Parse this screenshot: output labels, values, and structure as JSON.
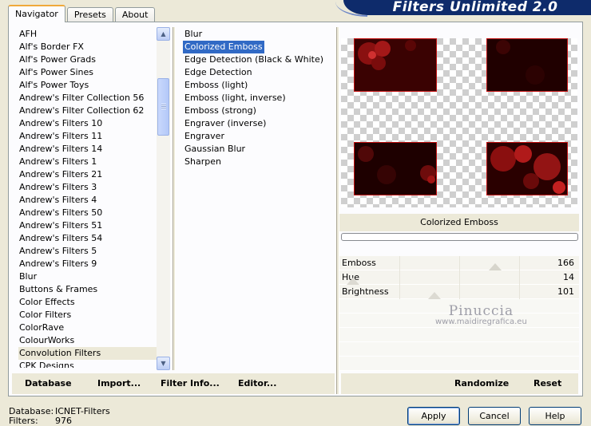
{
  "tabs": [
    {
      "label": "Navigator",
      "active": true
    },
    {
      "label": "Presets",
      "active": false
    },
    {
      "label": "About",
      "active": false
    }
  ],
  "banner": "Filters Unlimited 2.0",
  "categories": [
    "AFH",
    "Alf's Border FX",
    "Alf's Power Grads",
    "Alf's Power Sines",
    "Alf's Power Toys",
    "Andrew's Filter Collection 56",
    "Andrew's Filter Collection 62",
    "Andrew's Filters 10",
    "Andrew's Filters 11",
    "Andrew's Filters 14",
    "Andrew's Filters 1",
    "Andrew's Filters 21",
    "Andrew's Filters 3",
    "Andrew's Filters 4",
    "Andrew's Filters 50",
    "Andrew's Filters 51",
    "Andrew's Filters 54",
    "Andrew's Filters 5",
    "Andrew's Filters 9",
    "Blur",
    "Buttons & Frames",
    "Color Effects",
    "Color Filters",
    "ColorRave",
    "ColourWorks",
    "Convolution Filters",
    "CPK Designs"
  ],
  "selected_category": "Convolution Filters",
  "filters": [
    "Blur",
    "Colorized Emboss",
    "Edge Detection (Black & White)",
    "Edge Detection",
    "Emboss (light)",
    "Emboss (light, inverse)",
    "Emboss (strong)",
    "Engraver (inverse)",
    "Engraver",
    "Gaussian Blur",
    "Sharpen"
  ],
  "selected_filter": "Colorized Emboss",
  "left_buttons": {
    "database": "Database",
    "import": "Import...",
    "filter_info": "Filter Info...",
    "editor": "Editor..."
  },
  "filter_title": "Colorized Emboss",
  "params": [
    {
      "label": "Emboss",
      "value": "166",
      "level": 0.651
    },
    {
      "label": "Hue",
      "value": "14",
      "level": 0.055
    },
    {
      "label": "Brightness",
      "value": "101",
      "level": 0.396
    }
  ],
  "watermark": {
    "line1": "Pinuccia",
    "line2": "www.maidiregrafica.eu"
  },
  "right_buttons": {
    "randomize": "Randomize",
    "reset": "Reset"
  },
  "status": {
    "database_label": "Database:",
    "database_value": "ICNET-Filters",
    "filters_label": "Filters:",
    "filters_value": "976"
  },
  "dialog_buttons": {
    "apply": "Apply",
    "cancel": "Cancel",
    "help": "Help"
  },
  "colors": {
    "selection": "#316ac5",
    "banner": "#0e2b6b",
    "accent_tab": "#f0a93a",
    "image_red": "#c21010"
  }
}
